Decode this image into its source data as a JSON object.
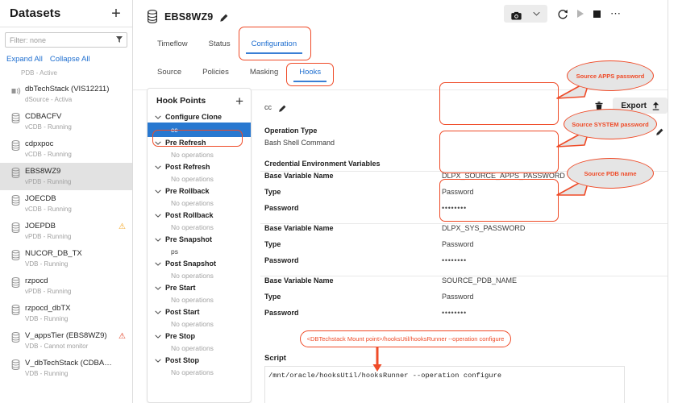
{
  "sidebar": {
    "title": "Datasets",
    "add_label": "+",
    "filter": {
      "text": "Filter: none",
      "icon": "filter-icon"
    },
    "expand_all": "Expand All",
    "collapse_all": "Collapse All",
    "partial_top": "PDB - Active",
    "items": [
      {
        "name": "dbTechStack (VIS12211)",
        "sub": "dSource - Activa",
        "icon": "dsource-icon",
        "warn": "",
        "selected": false
      },
      {
        "name": "CDBACFV",
        "sub": "vCDB - Running",
        "icon": "database-icon",
        "warn": "",
        "selected": false
      },
      {
        "name": "cdpxpoc",
        "sub": "vCDB - Running",
        "icon": "database-icon",
        "warn": "",
        "selected": false
      },
      {
        "name": "EBS8WZ9",
        "sub": "vPDB - Running",
        "icon": "database-icon",
        "warn": "",
        "selected": true
      },
      {
        "name": "JOECDB",
        "sub": "vCDB - Running",
        "icon": "database-icon",
        "warn": "",
        "selected": false
      },
      {
        "name": "JOEPDB",
        "sub": "vPDB - Running",
        "icon": "database-icon",
        "warn": "amber",
        "selected": false
      },
      {
        "name": "NUCOR_DB_TX",
        "sub": "VDB - Running",
        "icon": "database-icon",
        "warn": "",
        "selected": false
      },
      {
        "name": "rzpocd",
        "sub": "vPDB - Running",
        "icon": "database-icon",
        "warn": "",
        "selected": false
      },
      {
        "name": "rzpocd_dbTX",
        "sub": "VDB - Running",
        "icon": "database-icon",
        "warn": "",
        "selected": false
      },
      {
        "name": "V_appsTier (EBS8WZ9)",
        "sub": "VDB - Cannot monitor",
        "icon": "database-icon",
        "warn": "red",
        "selected": false
      },
      {
        "name": "V_dbTechStack (CDBA…",
        "sub": "VDB - Running",
        "icon": "database-icon",
        "warn": "",
        "selected": false
      }
    ]
  },
  "header": {
    "title": "EBS8WZ9",
    "edit_icon": "pencil-icon",
    "db_icon": "database-icon",
    "actions": {
      "snapshot_icon": "camera-icon",
      "snapshot_caret": "⌄",
      "refresh_icon": "refresh-icon",
      "start_icon": "play-icon",
      "stop_icon": "stop-icon",
      "more_icon": "more-icon"
    }
  },
  "tabs_primary": [
    {
      "label": "Timeflow",
      "active": false
    },
    {
      "label": "Status",
      "active": false
    },
    {
      "label": "Configuration",
      "active": true
    }
  ],
  "tabs_secondary": [
    {
      "label": "Source",
      "active": false
    },
    {
      "label": "Policies",
      "active": false
    },
    {
      "label": "Masking",
      "active": false
    },
    {
      "label": "Hooks",
      "active": true
    }
  ],
  "hook_points": {
    "title": "Hook Points",
    "add_label": "+",
    "no_ops_label": "No operations",
    "groups": [
      {
        "name": "Configure Clone",
        "caret": "chevron-down-icon",
        "items": [
          {
            "label": "cc",
            "selected": true
          }
        ]
      },
      {
        "name": "Pre Refresh",
        "caret": "chevron-down-icon",
        "items": [
          {
            "label": "No operations",
            "selected": false
          }
        ]
      },
      {
        "name": "Post Refresh",
        "caret": "chevron-down-icon",
        "items": [
          {
            "label": "No operations",
            "selected": false
          }
        ]
      },
      {
        "name": "Pre Rollback",
        "caret": "chevron-down-icon",
        "items": [
          {
            "label": "No operations",
            "selected": false
          }
        ]
      },
      {
        "name": "Post Rollback",
        "caret": "chevron-down-icon",
        "items": [
          {
            "label": "No operations",
            "selected": false
          }
        ]
      },
      {
        "name": "Pre Snapshot",
        "caret": "chevron-down-icon",
        "items": [
          {
            "label": "ps",
            "selected": false
          }
        ]
      },
      {
        "name": "Post Snapshot",
        "caret": "chevron-down-icon",
        "items": [
          {
            "label": "No operations",
            "selected": false
          }
        ]
      },
      {
        "name": "Pre Start",
        "caret": "chevron-down-icon",
        "items": [
          {
            "label": "No operations",
            "selected": false
          }
        ]
      },
      {
        "name": "Post Start",
        "caret": "chevron-down-icon",
        "items": [
          {
            "label": "No operations",
            "selected": false
          }
        ]
      },
      {
        "name": "Pre Stop",
        "caret": "chevron-down-icon",
        "items": [
          {
            "label": "No operations",
            "selected": false
          }
        ]
      },
      {
        "name": "Post Stop",
        "caret": "chevron-down-icon",
        "items": [
          {
            "label": "No operations",
            "selected": false
          }
        ]
      }
    ]
  },
  "detail": {
    "hook_name": "cc",
    "hook_edit_icon": "pencil-icon",
    "delete_icon": "trash-icon",
    "export_label": "Export",
    "export_icon": "upload-icon",
    "operation_type_label": "Operation Type",
    "operation_type_value": "Bash Shell Command",
    "operation_edit_icon": "pencil-icon",
    "cred_section_label": "Credential Environment Variables",
    "labels": {
      "base_variable_name": "Base Variable Name",
      "type": "Type",
      "password": "Password"
    },
    "credentials": [
      {
        "base_variable_name": "DLPX_SOURCE_APPS_PASSWORD",
        "type": "Password",
        "password": "••••••••"
      },
      {
        "base_variable_name": "DLPX_SYS_PASSWORD",
        "type": "Password",
        "password": "••••••••"
      },
      {
        "base_variable_name": "SOURCE_PDB_NAME",
        "type": "Password",
        "password": "••••••••"
      }
    ],
    "script_label": "Script",
    "script_value": "/mnt/oracle/hooksUtil/hooksRunner --operation configure"
  },
  "annotations": {
    "callouts": [
      {
        "text": "Source APPS password"
      },
      {
        "text": "Source SYSTEM password"
      },
      {
        "text": "Source PDB name"
      }
    ],
    "script_pill": "<DBTechstack Mount point>/hooksUtil/hooksRunner --operation configure",
    "accent_color": "#ef4b28"
  }
}
